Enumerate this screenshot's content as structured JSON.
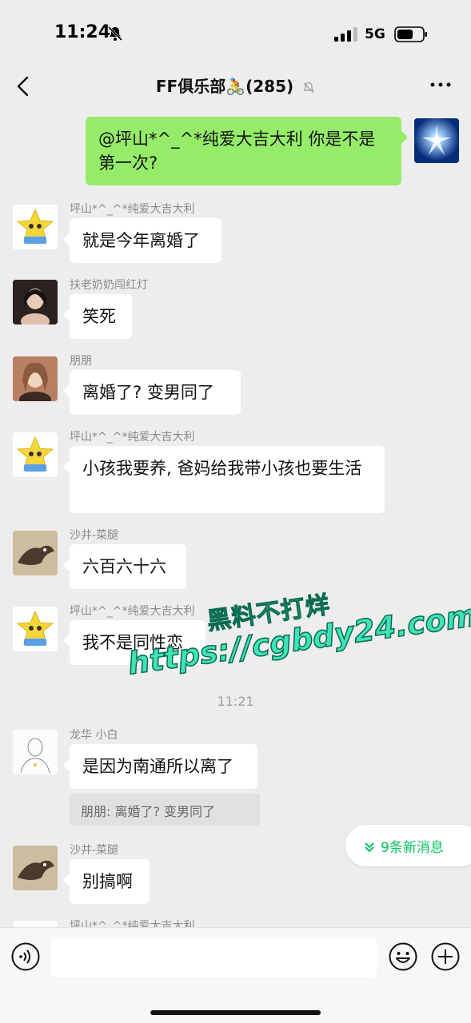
{
  "status_bar": {
    "time": "11:24",
    "network": "5G"
  },
  "nav": {
    "title": "FF俱乐部🚴(285)"
  },
  "messages": [
    {
      "sender": "",
      "text": "@坪山*^_^*纯爱大吉大利  你是不是第一次?",
      "self": true
    },
    {
      "sender": "坪山*^_^*纯爱大吉大利",
      "text": "就是今年离婚了"
    },
    {
      "sender": "扶老奶奶闯红灯",
      "text": "笑死"
    },
    {
      "sender": "朋朋",
      "text": "离婚了? 变男同了"
    },
    {
      "sender": "坪山*^_^*纯爱大吉大利",
      "text": "小孩我要养, 爸妈给我带小孩也要生活"
    },
    {
      "sender": "沙井-菜腿",
      "text": "六百六十六"
    },
    {
      "sender": "坪山*^_^*纯爱大吉大利",
      "text": "我不是同性恋"
    },
    {
      "sender": "龙华  小白",
      "text": "是因为南通所以离了",
      "quote": "朋朋: 离婚了? 变男同了"
    },
    {
      "sender": "沙井-菜腿",
      "text": "别搞啊"
    },
    {
      "sender": "坪山*^_^*纯爱大吉大利",
      "text": ""
    }
  ],
  "timestamp": "11:21",
  "new_messages": {
    "label": "9条新消息"
  },
  "watermark": {
    "line1": "黑料不打烊",
    "line2": "https://cgbdy24.com"
  },
  "icons": {
    "back": "chevron-left-icon",
    "more": "more-dots-icon",
    "mute": "bell-off-icon",
    "voice": "voice-icon",
    "emoji": "emoji-icon",
    "plus": "plus-icon"
  },
  "colors": {
    "accent": "#07c160",
    "self_bubble": "#95ec69",
    "background": "#ededed"
  }
}
